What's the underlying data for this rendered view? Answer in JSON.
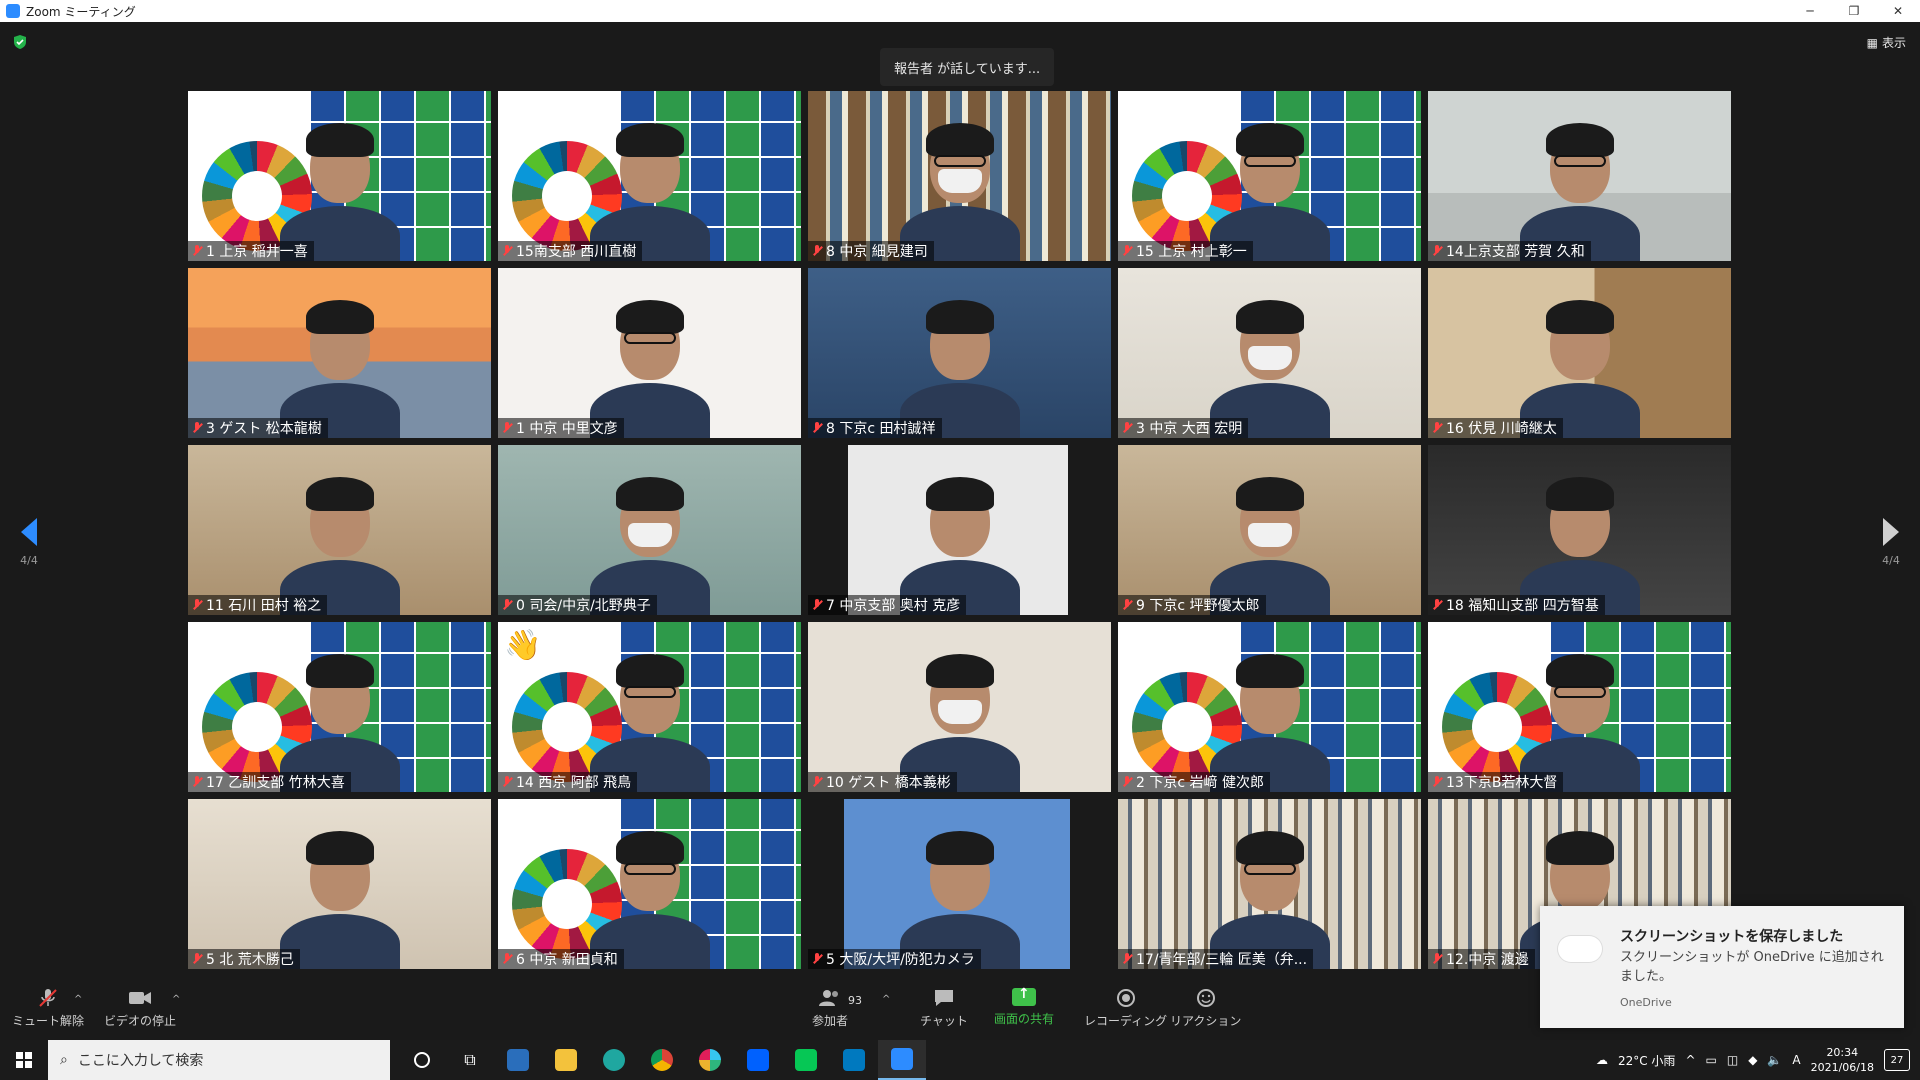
{
  "window": {
    "title": "Zoom ミーティング"
  },
  "meeting": {
    "speaking_banner": "報告者 が話しています...",
    "view_label": "表示",
    "page_indicator": "4/4"
  },
  "tiles": [
    {
      "name": "1  上京  稲井一喜",
      "bg": "bg-sdg",
      "sdg": true
    },
    {
      "name": "15南支部 西川直樹",
      "bg": "bg-sdg",
      "sdg": true
    },
    {
      "name": "8 中京 細見建司",
      "bg": "bg-shelf",
      "mask": true,
      "glasses": true
    },
    {
      "name": "15 上京  村上彰一",
      "bg": "bg-sdg",
      "sdg": true,
      "glasses": true
    },
    {
      "name": "14上京支部 芳賀 久和",
      "bg": "bg-office",
      "glasses": true
    },
    {
      "name": "3 ゲスト 松本龍樹",
      "bg": "bg-sunset"
    },
    {
      "name": "1 中京 中里文彦",
      "bg": "bg-brush",
      "glasses": true
    },
    {
      "name": "8 下京c 田村誠祥",
      "bg": "bg-blue"
    },
    {
      "name": "3 中京 大西 宏明",
      "bg": "bg-wall",
      "mask": true
    },
    {
      "name": "16  伏見 川崎継太",
      "bg": "bg-door"
    },
    {
      "name": "11 石川 田村 裕之",
      "bg": "bg-wood"
    },
    {
      "name": "0 司会/中京/北野典子",
      "bg": "bg-green",
      "mask": true
    },
    {
      "name": "7   中京支部  奥村 克彦",
      "bg": "bg-pattern"
    },
    {
      "name": "9 下京c 坪野優太郎",
      "bg": "bg-wood",
      "mask": true
    },
    {
      "name": "18 福知山支部 四方智基",
      "bg": "bg-dark"
    },
    {
      "name": "17  乙訓支部  竹林大喜",
      "bg": "bg-sdg",
      "sdg": true
    },
    {
      "name": "14 西京 阿部 飛鳥",
      "bg": "bg-sdg",
      "sdg": true,
      "glasses": true,
      "hand": true
    },
    {
      "name": "10 ゲスト 橋本義彬",
      "bg": "bg-cream",
      "mask": true
    },
    {
      "name": "2 下京c 岩﨑 健次郎",
      "bg": "bg-sdg",
      "sdg": true
    },
    {
      "name": "13下京B若林大督",
      "bg": "bg-sdg",
      "sdg": true,
      "glasses": true
    },
    {
      "name": "5 北  荒木勝己",
      "bg": "bg-room"
    },
    {
      "name": "6 中京 新田貞和",
      "bg": "bg-sdg",
      "sdg": true,
      "glasses": true
    },
    {
      "name": "5 大阪/大坪/防犯カメラ",
      "bg": "bg-sky"
    },
    {
      "name": "17/青年部/三輪 匠美（弁...",
      "bg": "bg-library",
      "glasses": true
    },
    {
      "name": "12.中京 渡邊",
      "bg": "bg-library"
    }
  ],
  "toolbar": {
    "mute": "ミュート解除",
    "video": "ビデオの停止",
    "participants": "参加者",
    "participant_count": "93",
    "chat": "チャット",
    "share": "画面の共有",
    "record": "レコーディング",
    "reactions": "リアクション"
  },
  "toast": {
    "title": "スクリーンショットを保存しました",
    "body": "スクリーンショットが OneDrive に追加されました。",
    "source": "OneDrive"
  },
  "taskbar": {
    "search_placeholder": "ここに入力して検索",
    "weather": "22°C 小雨",
    "time": "20:34",
    "date": "2021/06/18",
    "ime": "A",
    "notifications": "27"
  }
}
